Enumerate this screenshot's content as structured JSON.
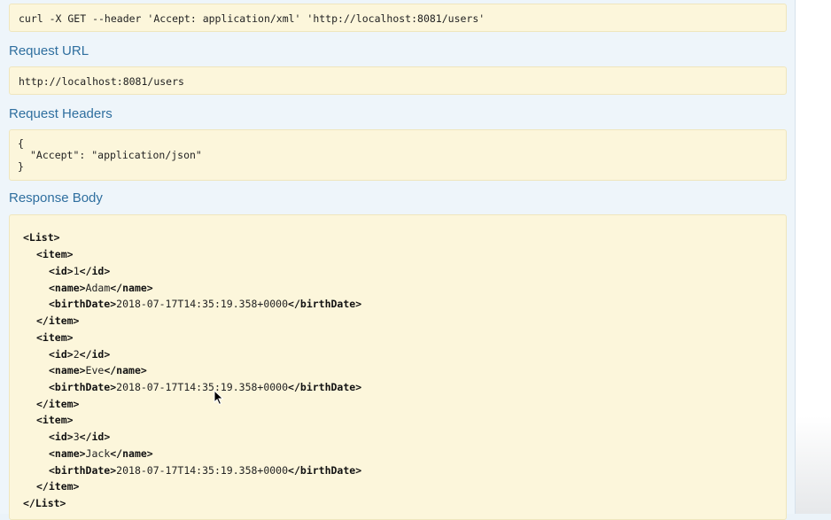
{
  "curl": {
    "command": "curl -X GET --header 'Accept: application/xml' 'http://localhost:8081/users'"
  },
  "request_url": {
    "title": "Request URL",
    "value": "http://localhost:8081/users"
  },
  "request_headers": {
    "title": "Request Headers",
    "open": "{",
    "entry": "\"Accept\": \"application/json\"",
    "close": "}"
  },
  "response_body": {
    "title": "Response Body",
    "root_open": "<List>",
    "root_close": "</List>",
    "items": [
      {
        "item_open": "<item>",
        "id_open": "<id>",
        "id": "1",
        "id_close": "</id>",
        "name_open": "<name>",
        "name": "Adam",
        "name_close": "</name>",
        "bd_open": "<birthDate>",
        "bd": "2018-07-17T14:35:19.358+0000",
        "bd_close": "</birthDate>",
        "item_close": "</item>"
      },
      {
        "item_open": "<item>",
        "id_open": "<id>",
        "id": "2",
        "id_close": "</id>",
        "name_open": "<name>",
        "name": "Eve",
        "name_close": "</name>",
        "bd_open": "<birthDate>",
        "bd": "2018-07-17T14:35:19.358+0000",
        "bd_close": "</birthDate>",
        "item_close": "</item>"
      },
      {
        "item_open": "<item>",
        "id_open": "<id>",
        "id": "3",
        "id_close": "</id>",
        "name_open": "<name>",
        "name": "Jack",
        "name_close": "</name>",
        "bd_open": "<birthDate>",
        "bd": "2018-07-17T14:35:19.358+0000",
        "bd_close": "</birthDate>",
        "item_close": "</item>"
      }
    ]
  },
  "icons": {
    "mouse_cursor": "mouse-pointer-icon"
  }
}
